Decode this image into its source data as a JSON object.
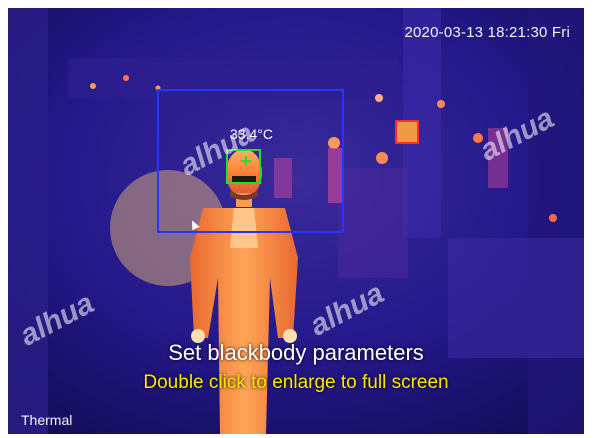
{
  "timestamp": "2020-03-13 18:21:30 Fri",
  "channel_label": "Thermal",
  "measurement": {
    "temperature": "33.4°C"
  },
  "captions": {
    "title": "Set blackbody parameters",
    "subtitle": "Double click to enlarge to full screen"
  },
  "watermark": {
    "brand": "alhua"
  },
  "colors": {
    "detection_box": "#2a34ff",
    "face_box": "#22e02a",
    "blackbody_marker": "#ff2a2a",
    "caption_primary": "#ffffff",
    "caption_secondary": "#ffe600"
  }
}
